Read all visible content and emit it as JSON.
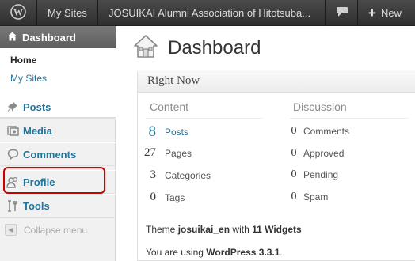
{
  "adminbar": {
    "wp_icon": "wordpress-logo-icon",
    "my_sites": "My Sites",
    "site_name": "JOSUIKAI Alumni Association of Hitotsuba...",
    "comments_icon": "speech-bubble-icon",
    "new_label": "New",
    "new_icon": "plus-icon"
  },
  "sidebar": {
    "dashboard": "Dashboard",
    "submenu": {
      "home": "Home",
      "my_sites": "My Sites"
    },
    "items": [
      {
        "label": "Posts",
        "icon": "pushpin-icon"
      },
      {
        "label": "Media",
        "icon": "media-icon"
      },
      {
        "label": "Comments",
        "icon": "speech-bubble-icon"
      },
      {
        "label": "Profile",
        "icon": "users-icon"
      },
      {
        "label": "Tools",
        "icon": "tools-icon"
      }
    ],
    "collapse": "Collapse menu",
    "highlight_color": "#cc0000"
  },
  "main": {
    "title": "Dashboard",
    "title_icon": "house-icon",
    "panel": {
      "title": "Right Now",
      "content_head": "Content",
      "discussion_head": "Discussion",
      "content": [
        {
          "count": "8",
          "label": "Posts"
        },
        {
          "count": "27",
          "label": "Pages"
        },
        {
          "count": "3",
          "label": "Categories"
        },
        {
          "count": "0",
          "label": "Tags"
        }
      ],
      "discussion": [
        {
          "count": "0",
          "label": "Comments"
        },
        {
          "count": "0",
          "label": "Approved"
        },
        {
          "count": "0",
          "label": "Pending"
        },
        {
          "count": "0",
          "label": "Spam"
        }
      ],
      "theme": {
        "prefix": "Theme",
        "name": "josuikai_en",
        "with": "with",
        "widgets": "11 Widgets"
      },
      "version": {
        "prefix": "You are using",
        "name": "WordPress 3.3.1",
        "suffix": "."
      }
    }
  },
  "colors": {
    "link": "#21759b",
    "adminbar": "#3a3a3a",
    "menu_active": "#6d6d6d"
  }
}
